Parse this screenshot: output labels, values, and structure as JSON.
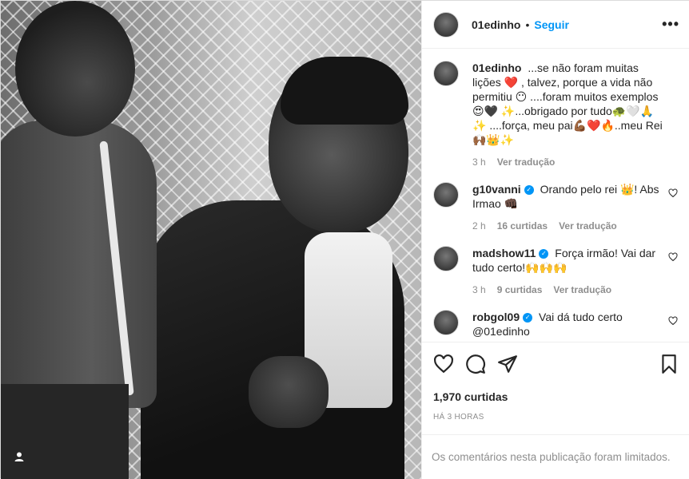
{
  "post": {
    "author": "01edinho",
    "follow_label": "Seguir",
    "more_label": "•••",
    "separator": "•"
  },
  "caption": {
    "username": "01edinho",
    "text_line1": "...se não foram muitas lições ❤️ , talvez, porque a vida não permitiu 😶 ....foram muitos exemplos😍🖤 ✨...obrigado por tudo🐢🤍🙏 ✨ ....força, meu pai💪🏾❤️🔥..meu Rei 🙌🏾👑✨",
    "time": "3 h",
    "translate": "Ver tradução"
  },
  "comments": [
    {
      "username": "g10vanni",
      "text": "Orando pelo rei 👑! Abs Irmao 👊🏿",
      "time": "2 h",
      "likes": "16 curtidas",
      "translate": "Ver tradução"
    },
    {
      "username": "madshow11",
      "text": "Força irmão! Vai dar tudo certo!🙌🙌🙌",
      "time": "3 h",
      "likes": "9 curtidas",
      "translate": "Ver tradução"
    },
    {
      "username": "robgol09",
      "text": "Vai dá tudo certo @01edinho",
      "time": "",
      "likes": "",
      "translate": ""
    }
  ],
  "actions": {
    "likes_count": "1,970 curtidas",
    "post_date": "HÁ 3 HORAS"
  },
  "footer": {
    "limited_text": "Os comentários nesta publicação foram limitados."
  },
  "icons": {
    "like": "heart-icon",
    "comment": "comment-icon",
    "share": "share-icon",
    "save": "bookmark-icon",
    "tag": "user-tag-icon"
  },
  "colors": {
    "link_blue": "#0095f6",
    "muted": "#8e8e8e",
    "text": "#262626"
  }
}
